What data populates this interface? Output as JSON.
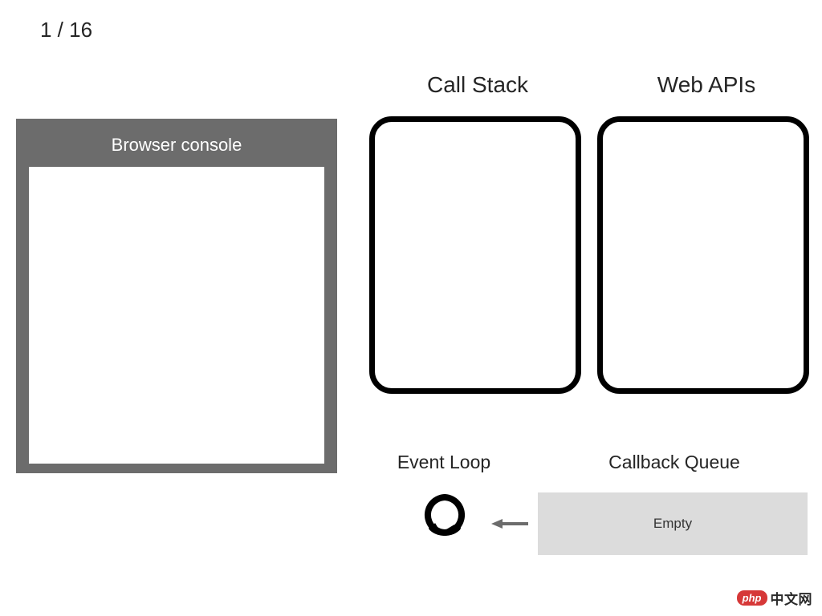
{
  "page": {
    "current": 1,
    "total": 16,
    "counter_text": "1 / 16"
  },
  "browser_console": {
    "title": "Browser console"
  },
  "sections": {
    "call_stack": "Call Stack",
    "web_apis": "Web APIs",
    "event_loop": "Event Loop",
    "callback_queue": "Callback Queue"
  },
  "callback_queue": {
    "status": "Empty"
  },
  "watermark": {
    "badge": "php",
    "text": "中文网"
  }
}
